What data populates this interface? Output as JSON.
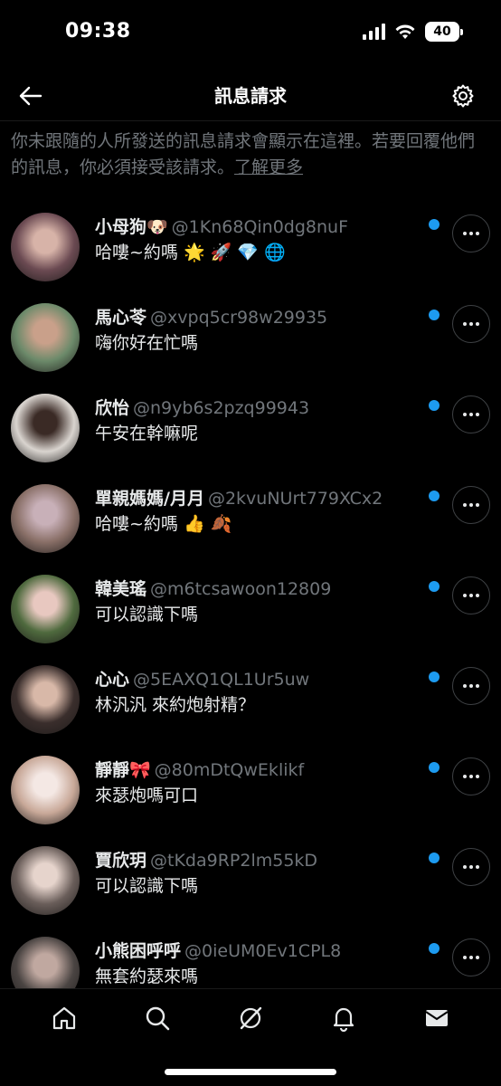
{
  "status": {
    "time": "09:38",
    "battery": "40"
  },
  "header": {
    "title": "訊息請求"
  },
  "notice": {
    "text": "你未跟隨的人所發送的訊息請求會顯示在這裡。若要回覆他們的訊息，你必須接受該請求。",
    "link": "了解更多"
  },
  "requests": [
    {
      "name": "小母狗🐶",
      "handle": "@1Kn68Qin0dg8nuF",
      "message": "哈嘍~約嗎 🌟 🚀 💎 🌐",
      "avatar_color": "#6b4a52",
      "avatar_accent": "#d7b3a8"
    },
    {
      "name": "馬心苓",
      "handle": "@xvpq5cr98w29935",
      "message": "嗨你好在忙嗎",
      "avatar_color": "#6c8a6a",
      "avatar_accent": "#c9a08a"
    },
    {
      "name": "欣怡",
      "handle": "@n9yb6s2pzq99943",
      "message": "午安在幹嘛呢",
      "avatar_color": "#d9d4cf",
      "avatar_accent": "#3a2a25"
    },
    {
      "name": "單親媽媽/月月",
      "handle": "@2kvuNUrt779XCx2",
      "message": "哈嘍~約嗎 👍 🍂",
      "avatar_color": "#8a7068",
      "avatar_accent": "#c8b0b8"
    },
    {
      "name": "韓美瑤",
      "handle": "@m6tcsawoon12809",
      "message": "可以認識下嗎",
      "avatar_color": "#4f6a3e",
      "avatar_accent": "#e8c8c0"
    },
    {
      "name": "心心",
      "handle": "@5EAXQ1QL1Ur5uw",
      "message": "林汎汎 來約炮射精？",
      "avatar_color": "#3a2e2c",
      "avatar_accent": "#d8b8a8"
    },
    {
      "name": "靜靜🎀",
      "handle": "@80mDtQwEklikf",
      "message": "來瑟炮嗎可口",
      "avatar_color": "#c8a898",
      "avatar_accent": "#f4e8e4"
    },
    {
      "name": "賈欣玥",
      "handle": "@tKda9RP2lm55kD",
      "message": "可以認識下嗎",
      "avatar_color": "#6a5e5a",
      "avatar_accent": "#e6d4cc"
    },
    {
      "name": "小熊困呼呼",
      "handle": "@0ieUM0Ev1CPL8",
      "message": "無套約瑟來嗎",
      "avatar_color": "#4a4442",
      "avatar_accent": "#c0a8a0"
    }
  ],
  "colors": {
    "accent": "#1d9bf0",
    "background": "#000000",
    "secondary_text": "#71767b"
  },
  "tabs": [
    "home-icon",
    "search-icon",
    "grok-icon",
    "notifications-icon",
    "messages-icon"
  ]
}
